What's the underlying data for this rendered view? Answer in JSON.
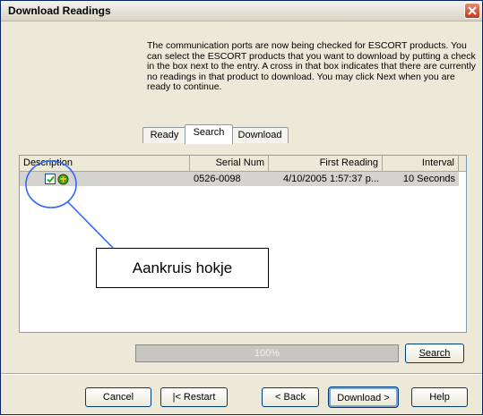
{
  "window": {
    "title": "Download Readings"
  },
  "intro_text": "The communication ports are now being checked for ESCORT products. You can select the ESCORT products that you want to download by putting a check in the box next to the entry. A cross in that box indicates that there are currently no readings in that product to download. You may click Next when you are ready to continue.",
  "tabs": [
    {
      "label": "Ready",
      "active": false
    },
    {
      "label": "Search",
      "active": true
    },
    {
      "label": "Download",
      "active": false
    }
  ],
  "table": {
    "headers": [
      "Description",
      "Serial Num",
      "First Reading",
      "Interval"
    ],
    "rows": [
      {
        "checked": true,
        "icon": "escort-product-icon",
        "serial": "0526-0098",
        "first_reading": "4/10/2005 1:57:37 p...",
        "interval": "10 Seconds"
      }
    ]
  },
  "progress": {
    "text": "100%",
    "value": 1.0
  },
  "buttons": {
    "search": "Search",
    "cancel": "Cancel",
    "restart": "|< Restart",
    "back": "< Back",
    "download": "Download >",
    "help": "Help"
  },
  "annotation": {
    "text": "Aankruis hokje"
  },
  "colors": {
    "selection_row": "#d5d3ce",
    "callout_line": "#3366ff"
  }
}
